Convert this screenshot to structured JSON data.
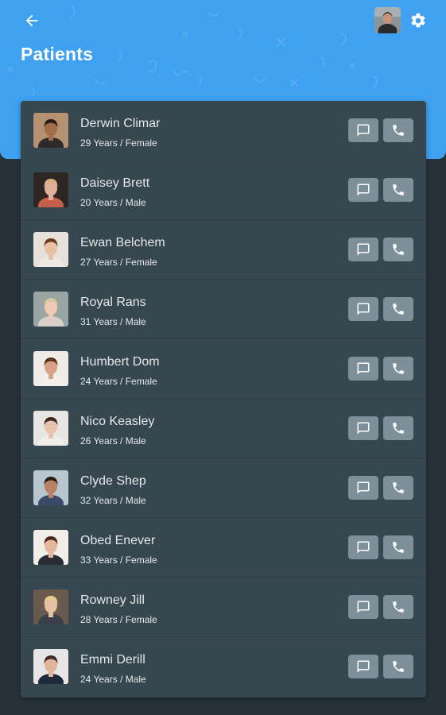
{
  "header": {
    "title": "Patients",
    "back_icon": "arrow-left-icon",
    "settings_icon": "gear-icon",
    "profile_avatar": "user-avatar",
    "accent_color": "#3fa1ef",
    "background_color": "#263238",
    "card_color": "#37474f",
    "button_color": "#7d8f98"
  },
  "patients": [
    {
      "name": "Derwin Climar",
      "meta": "29 Years / Female",
      "avatar_colors": {
        "bg": "#b59272",
        "skin": "#a16d4c",
        "hair": "#2a1a12",
        "shirt": "#2b2b2b"
      }
    },
    {
      "name": "Daisey Brett",
      "meta": "20 Years / Male",
      "avatar_colors": {
        "bg": "#2e2622",
        "skin": "#e0b09a",
        "hair": "#d7b083",
        "shirt": "#c4604a"
      }
    },
    {
      "name": "Ewan Belchem",
      "meta": "27 Years / Female",
      "avatar_colors": {
        "bg": "#e7e1da",
        "skin": "#e8c0a6",
        "hair": "#6b3d23",
        "shirt": "#efe8e2"
      }
    },
    {
      "name": "Royal Rans",
      "meta": "31 Years / Male",
      "avatar_colors": {
        "bg": "#9aa4a3",
        "skin": "#efcbb3",
        "hair": "#d9c39b",
        "shirt": "#d7d0c9"
      }
    },
    {
      "name": "Humbert Dom",
      "meta": "24 Years / Female",
      "avatar_colors": {
        "bg": "#efebe6",
        "skin": "#d9a286",
        "hair": "#5a2f1c",
        "shirt": "#f2efeb"
      }
    },
    {
      "name": "Nico Keasley",
      "meta": "26 Years / Male",
      "avatar_colors": {
        "bg": "#e8e6e4",
        "skin": "#e8c4ae",
        "hair": "#3b2a20",
        "shirt": "#f0eeec"
      }
    },
    {
      "name": "Clyde Shep",
      "meta": "32 Years / Male",
      "avatar_colors": {
        "bg": "#b8c6cf",
        "skin": "#b98363",
        "hair": "#2a1d16",
        "shirt": "#3b4a6b"
      }
    },
    {
      "name": "Obed Enever",
      "meta": "33 Years / Female",
      "avatar_colors": {
        "bg": "#f1ede8",
        "skin": "#e4b89c",
        "hair": "#4a2c1c",
        "shirt": "#2a2c33"
      }
    },
    {
      "name": "Rowney Jill",
      "meta": "28 Years / Female",
      "avatar_colors": {
        "bg": "#6a5a4d",
        "skin": "#e8c3a3",
        "hair": "#e3cd8f",
        "shirt": "#3b3f4a"
      }
    },
    {
      "name": "Emmi Derill",
      "meta": "24 Years / Male",
      "avatar_colors": {
        "bg": "#e6e6e6",
        "skin": "#e0b59a",
        "hair": "#3b2b22",
        "shirt": "#1f2a3a"
      }
    }
  ],
  "row_actions": {
    "message_icon": "message-icon",
    "call_icon": "phone-icon"
  }
}
